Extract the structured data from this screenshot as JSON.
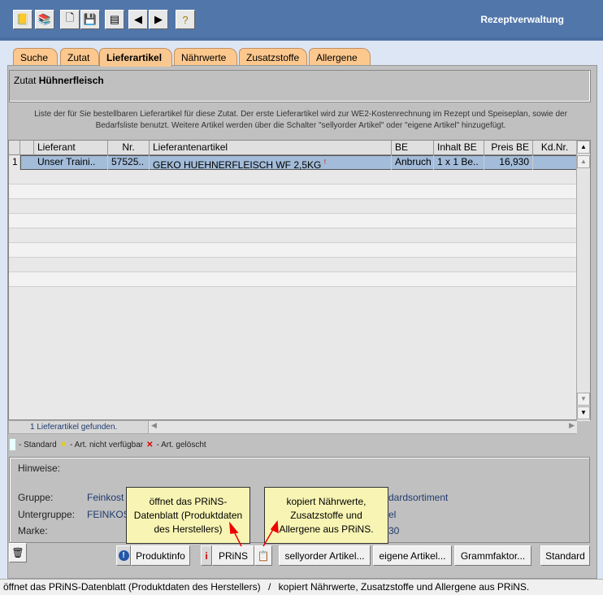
{
  "header": {
    "title": "Rezeptverwaltung",
    "toolbar": [
      "book-icon",
      "books-icon",
      "new-document-icon",
      "save-icon",
      "add-list-icon",
      "back-arrow-icon",
      "forward-arrow-icon",
      "help-icon"
    ]
  },
  "tabs": [
    {
      "label": "Suche"
    },
    {
      "label": "Zutat"
    },
    {
      "label": "Lieferartikel",
      "active": true
    },
    {
      "label": "Nährwerte"
    },
    {
      "label": "Zusatzstoffe"
    },
    {
      "label": "Allergene"
    }
  ],
  "zutat": {
    "label": "Zutat",
    "name": "Hühnerfleisch"
  },
  "description": [
    "Liste der für Sie bestellbaren Lieferartikel für diese Zutat.  Der erste Lieferartikel wird zur WE2-Kostenrechnung im Rezept und Speiseplan, sowie der",
    "Bedarfsliste benutzt.  Weitere Artikel werden über die Schalter \"sellyorder Artikel\" oder \"eigene Artikel\" hinzugefügt."
  ],
  "table": {
    "columns": [
      "Lieferant",
      "Nr.",
      "Lieferantenartikel",
      "BE",
      "Inhalt BE",
      "Preis BE",
      "Kd.Nr."
    ],
    "rows": [
      {
        "index": "1",
        "lieferant": "Unser Traini..",
        "nr": "57525..",
        "artikel": "GEKO HUEHNERFLEISCH WF 2,5KG",
        "marker": "!",
        "be": "Anbruch",
        "inhalt": "1 x 1 Be..",
        "preis": "16,930",
        "kdnr": ""
      }
    ],
    "footer": "1  Lieferartikel gefunden."
  },
  "legend": {
    "standard": "- Standard",
    "nicht_verfuegbar": "- Art. nicht verfügbar",
    "geloescht": "- Art. gelöscht"
  },
  "hinweise": {
    "label": "Hinweise:",
    "gruppe_label": "Gruppe:",
    "gruppe": "Feinkost",
    "gruppe_right": "dardsortiment",
    "untergruppe_label": "Untergruppe:",
    "untergruppe": "FEINKOS",
    "untergruppe_right": "el",
    "marke_label": "Marke:",
    "marke_right": "30"
  },
  "tooltips": {
    "prins": "öffnet das PRiNS-Datenblatt (Produktdaten des Herstellers)",
    "copy": "kopiert Nährwerte, Zusatzstoffe und Allergene aus PRiNS."
  },
  "buttons": {
    "produktinfo": "Produktinfo",
    "prins": "PRiNS",
    "sellyorder": "sellyorder Artikel...",
    "eigene": "eigene Artikel...",
    "grammfaktor": "Grammfaktor...",
    "standard": "Standard"
  },
  "status": {
    "left": "öffnet das PRiNS-Datenblatt (Produktdaten des Herstellers)",
    "sep": "/",
    "right": "kopiert Nährwerte, Zusatzstoffe und Allergene aus PRiNS."
  }
}
